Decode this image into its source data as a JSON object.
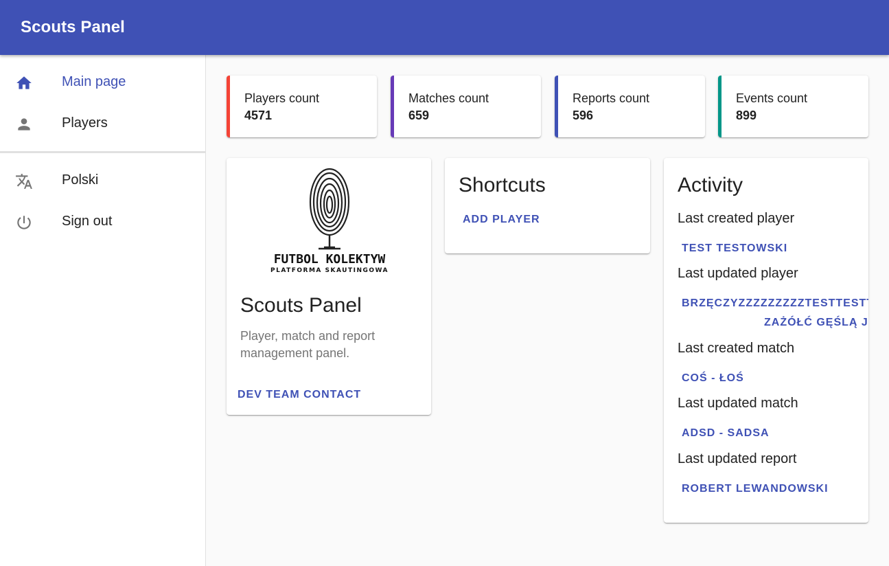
{
  "app": {
    "title": "Scouts Panel"
  },
  "sidebar": {
    "items": [
      {
        "label": "Main page",
        "icon": "home-icon"
      },
      {
        "label": "Players",
        "icon": "person-icon"
      },
      {
        "label": "Polski",
        "icon": "translate-icon"
      },
      {
        "label": "Sign out",
        "icon": "power-icon"
      }
    ]
  },
  "stats": [
    {
      "label": "Players count",
      "value": "4571",
      "color": "#f44336"
    },
    {
      "label": "Matches count",
      "value": "659",
      "color": "#673ab7"
    },
    {
      "label": "Reports count",
      "value": "596",
      "color": "#3f51b5"
    },
    {
      "label": "Events count",
      "value": "899",
      "color": "#009688"
    }
  ],
  "about": {
    "logo_text": "FUTBOL KOLEKTYW",
    "logo_subtext": "PLATFORMA SKAUTINGOWA",
    "title": "Scouts Panel",
    "description": "Player, match and report management panel.",
    "contact_button": "DEV TEAM CONTACT"
  },
  "shortcuts": {
    "title": "Shortcuts",
    "add_player": "ADD PLAYER"
  },
  "activity": {
    "title": "Activity",
    "last_created_player_label": "Last created player",
    "last_created_player": "TEST TESTOWSKI",
    "last_updated_player_label": "Last updated player",
    "last_updated_player_line1": "BRZĘCZYZZZZZZZZZTESTTESTTES",
    "last_updated_player_line2": "ZAŻÓŁĆ GĘŚLĄ JAŹ",
    "last_created_match_label": "Last created match",
    "last_created_match": "COŚ - ŁOŚ",
    "last_updated_match_label": "Last updated match",
    "last_updated_match": "ADSD - SADSA",
    "last_updated_report_label": "Last updated report",
    "last_updated_report": "ROBERT LEWANDOWSKI"
  },
  "colors": {
    "primary": "#3f51b5"
  }
}
